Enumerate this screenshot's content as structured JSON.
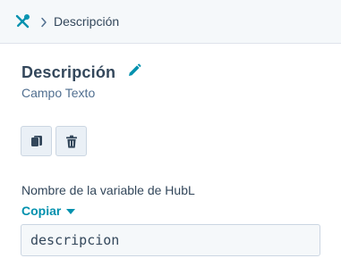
{
  "breadcrumb": {
    "label": "Descripción"
  },
  "field": {
    "title": "Descripción",
    "type": "Campo Texto"
  },
  "hubl": {
    "label": "Nombre de la variable de HubL",
    "copy_label": "Copiar",
    "value": "descripcion"
  },
  "icons": {
    "tools": "tools-icon",
    "chevron": "chevron-right-icon",
    "edit": "pencil-icon",
    "clone": "clone-icon",
    "delete": "trash-icon",
    "caret": "caret-down-icon"
  },
  "colors": {
    "accent": "#0091ae",
    "text": "#33475b",
    "panel_bg": "#f5f8fa",
    "border": "#cbd6e2"
  }
}
